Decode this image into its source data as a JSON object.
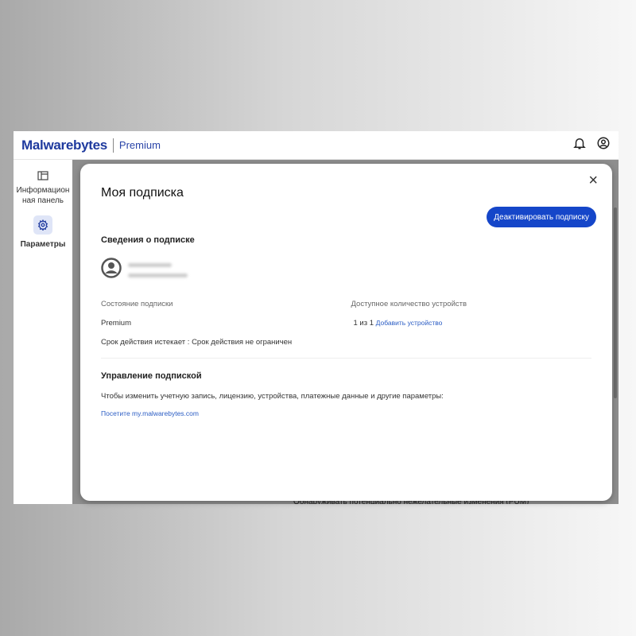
{
  "header": {
    "brand": "Malwarebytes",
    "product": "Premium"
  },
  "sidebar": {
    "items": [
      {
        "label": "Информационная панель",
        "line1": "Информацион",
        "line2": "ная панель"
      },
      {
        "label": "Параметры"
      }
    ]
  },
  "background": {
    "text": "Обнаруживать потенциально нежелательные изменения (PUM)"
  },
  "modal": {
    "title": "Моя подписка",
    "close": "×",
    "deactivate_label": "Деактивировать подписку",
    "info_heading": "Сведения о подписке",
    "status_label": "Состояние подписки",
    "status_value": "Premium",
    "expiry": "Срок действия истекает : Срок действия не ограничен",
    "devices_label": "Доступное количество устройств",
    "devices_value": "1 из 1",
    "add_device": "Добавить устройство",
    "manage_heading": "Управление подпиской",
    "manage_text": "Чтобы изменить учетную запись, лицензию, устройства, платежные данные и другие параметры:",
    "manage_link": "Посетите my.malwarebytes.com"
  }
}
